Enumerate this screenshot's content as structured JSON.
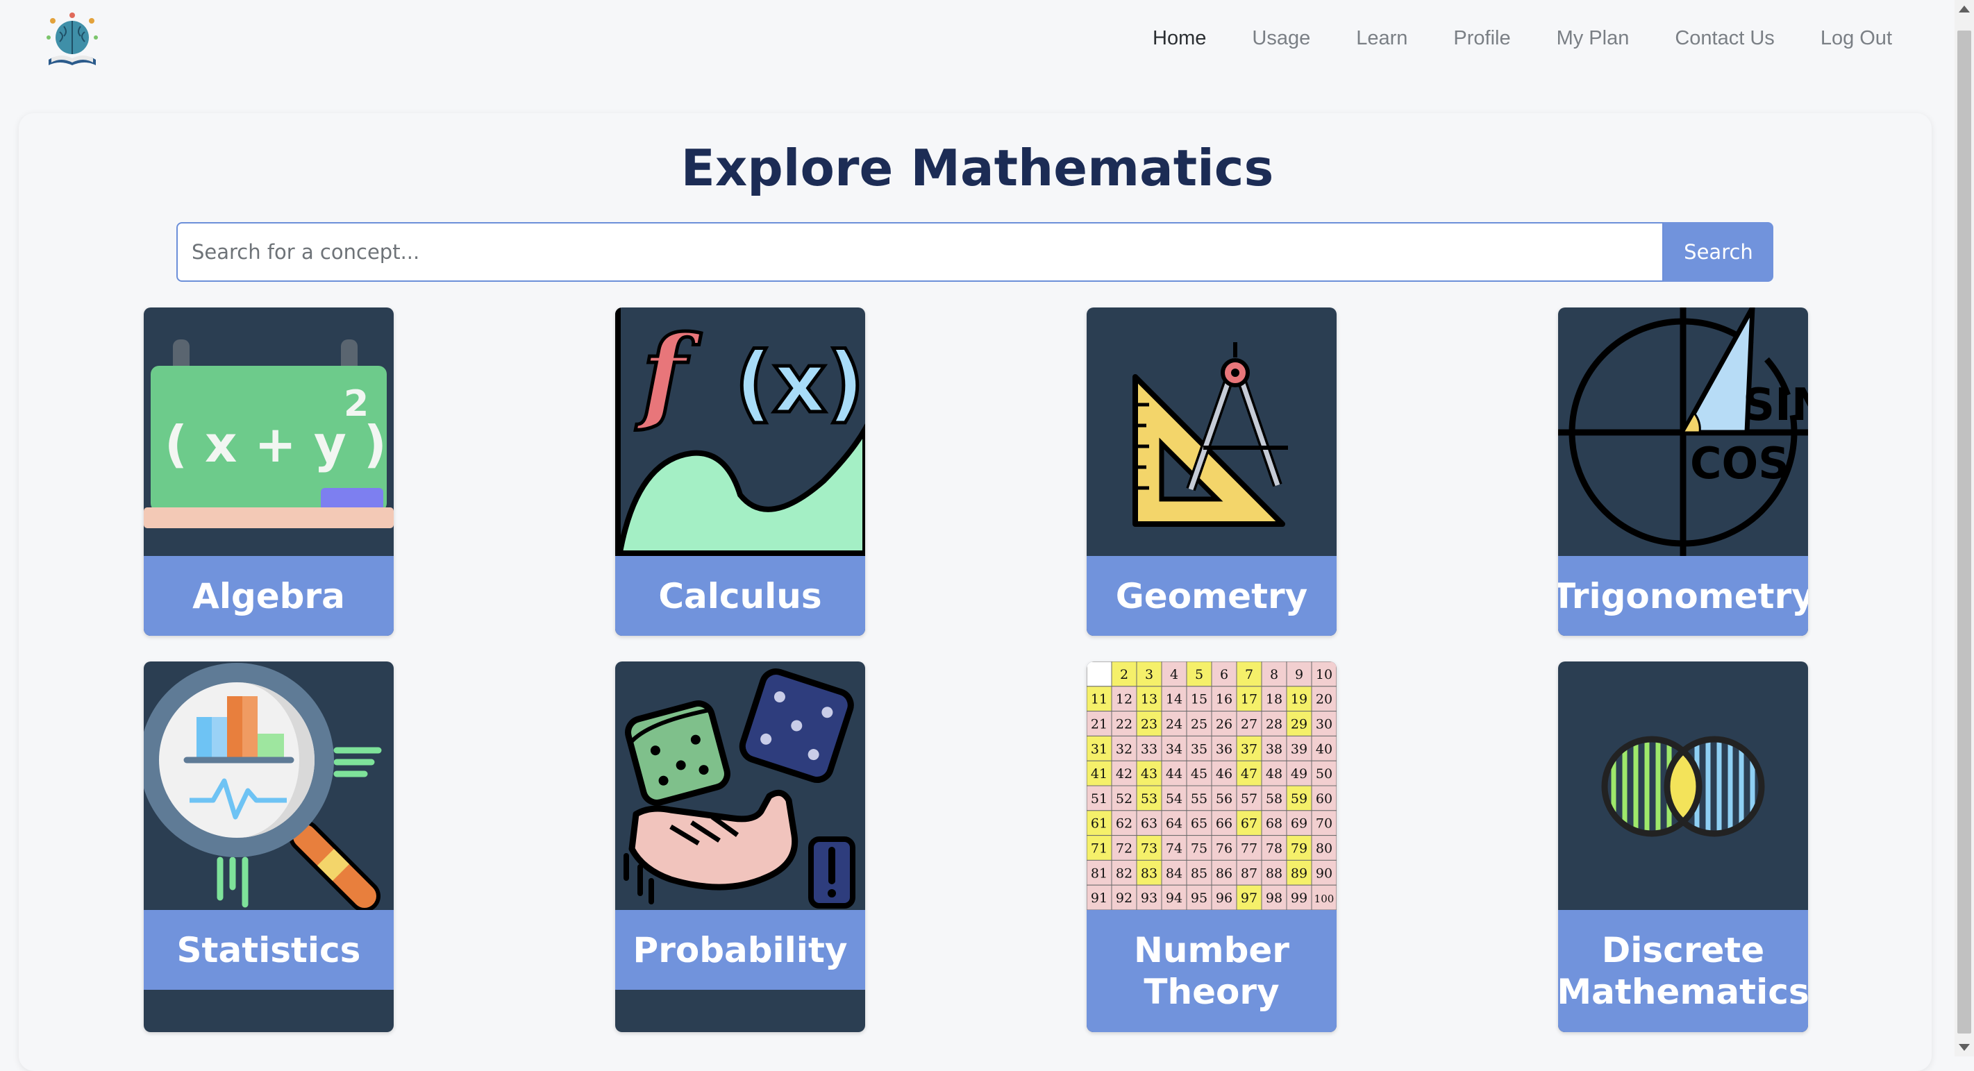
{
  "nav": {
    "links": [
      "Home",
      "Usage",
      "Learn",
      "Profile",
      "My Plan",
      "Contact Us",
      "Log Out"
    ],
    "active": "Home"
  },
  "main": {
    "title": "Explore Mathematics",
    "search": {
      "placeholder": "Search for a concept...",
      "value": "",
      "button_label": "Search"
    },
    "topics": [
      {
        "label": "Algebra",
        "icon": "chalkboard-formula-icon",
        "formula": "( x + y )",
        "exponent": "2"
      },
      {
        "label": "Calculus",
        "icon": "function-graph-icon",
        "fx": "f",
        "paren_x": "(x)"
      },
      {
        "label": "Geometry",
        "icon": "ruler-compass-icon"
      },
      {
        "label": "Trigonometry",
        "icon": "unit-circle-icon",
        "sin": "SIN",
        "cos": "COS"
      },
      {
        "label": "Statistics",
        "icon": "magnifier-chart-icon"
      },
      {
        "label": "Probability",
        "icon": "dice-hand-icon"
      },
      {
        "label": "Number Theory",
        "icon": "number-grid-icon"
      },
      {
        "label": "Discrete Mathematics",
        "icon": "venn-diagram-icon"
      }
    ]
  },
  "colors": {
    "title": "#1c2c55",
    "accent": "#7193dc",
    "card_bg": "#2b3e52"
  }
}
